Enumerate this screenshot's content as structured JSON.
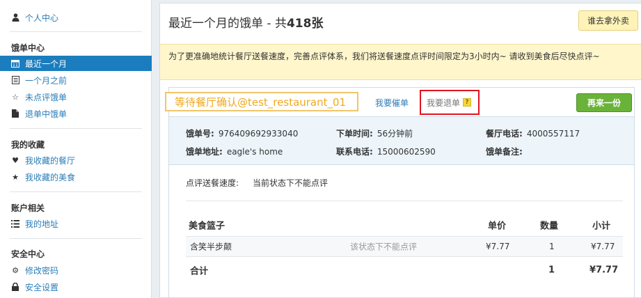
{
  "sidebar": {
    "user_center": "个人中心",
    "orders_heading": "饿单中心",
    "orders": [
      {
        "label": "最近一个月",
        "icon": "calendar-icon",
        "active": true
      },
      {
        "label": "一个月之前",
        "icon": "list-icon",
        "active": false
      },
      {
        "label": "未点评饿单",
        "icon": "star-outline-icon",
        "active": false
      },
      {
        "label": "退单中饿单",
        "icon": "document-icon",
        "active": false
      }
    ],
    "fav_heading": "我的收藏",
    "favs": [
      {
        "label": "我收藏的餐厅",
        "icon": "heart-icon"
      },
      {
        "label": "我收藏的美食",
        "icon": "star-icon"
      }
    ],
    "account_heading": "账户相关",
    "account": [
      {
        "label": "我的地址",
        "icon": "list-icon"
      }
    ],
    "security_heading": "安全中心",
    "security": [
      {
        "label": "修改密码",
        "icon": "gear-icon"
      },
      {
        "label": "安全设置",
        "icon": "lock-icon"
      }
    ]
  },
  "header": {
    "title_prefix": "最近一个月的饿单 - 共",
    "count": "418",
    "title_suffix": "张",
    "takeout_button": "谁去拿外卖"
  },
  "notice": "为了更准确地统计餐厅送餐速度，完善点评体系，我们将送餐速度点评时间限定为3小时内~ 请收到美食后尽快点评~",
  "order": {
    "status": "等待餐厅确认@test_restaurant_01",
    "urge_link": "我要催单",
    "refund_link": "我要退单",
    "help_icon_text": "?",
    "again_button": "再来一份",
    "info": {
      "order_no_label": "饿单号:",
      "order_no": "976409692933040",
      "order_time_label": "下单时间:",
      "order_time": "56分钟前",
      "restaurant_phone_label": "餐厅电话:",
      "restaurant_phone": "4000557117",
      "address_label": "饿单地址:",
      "address": "eagle's home",
      "contact_phone_label": "联系电话:",
      "contact_phone": "15000602590",
      "remark_label": "饿单备注:",
      "remark": ""
    },
    "rating_label": "点评送餐速度:",
    "rating_value": "当前状态下不能点评",
    "table": {
      "headers": {
        "basket": "美食篮子",
        "price": "单价",
        "qty": "数量",
        "subtotal": "小计"
      },
      "rows": [
        {
          "name": "含笑半步颠",
          "note": "该状态下不能点评",
          "price": "¥7.77",
          "qty": "1",
          "subtotal": "¥7.77"
        }
      ],
      "total": {
        "label": "合计",
        "qty": "1",
        "amount": "¥7.77"
      }
    }
  }
}
